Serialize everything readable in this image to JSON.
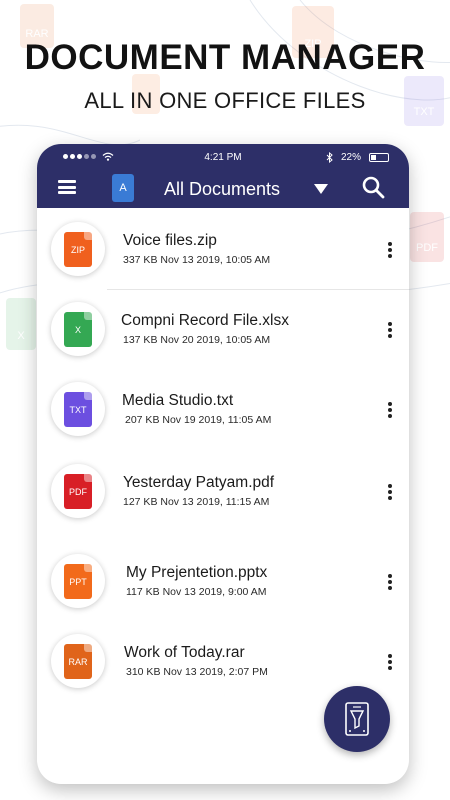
{
  "promo": {
    "headline": "DOCUMENT MANAGER",
    "subheadline": "ALL IN ONE OFFICE FILES"
  },
  "status_bar": {
    "time": "4:21 PM",
    "battery": "22%"
  },
  "app_bar": {
    "title": "All Documents",
    "logo_letter": "A",
    "bg_color": "#2d2f68"
  },
  "files": [
    {
      "name": "Voice files.zip",
      "meta": "337 KB Nov 13 2019, 10:05 AM",
      "type": "ZIP",
      "color": "#f0601e"
    },
    {
      "name": "Compni Record File.xlsx",
      "meta": "137 KB Nov 20 2019, 10:05 AM",
      "type": "X",
      "color": "#34a853"
    },
    {
      "name": "Media Studio.txt",
      "meta": "207 KB Nov 19 2019, 11:05 AM",
      "type": "TXT",
      "color": "#6c4fe0"
    },
    {
      "name": "Yesterday Patyam.pdf",
      "meta": "127 KB Nov 13 2019, 11:15 AM",
      "type": "PDF",
      "color": "#d81f26"
    },
    {
      "name": "My Prejentetion.pptx",
      "meta": "117 KB Nov 13 2019, 9:00 AM",
      "type": "PPT",
      "color": "#f26a1b"
    },
    {
      "name": "Work of Today.rar",
      "meta": "310 KB Nov 13 2019, 2:07 PM",
      "type": "RAR",
      "color": "#e0641a"
    }
  ],
  "icons": {
    "menu": "menu-icon",
    "dropdown": "triangle-down-icon",
    "search": "search-icon",
    "more": "more-vertical-icon",
    "fab": "cleaner-brush-icon"
  }
}
